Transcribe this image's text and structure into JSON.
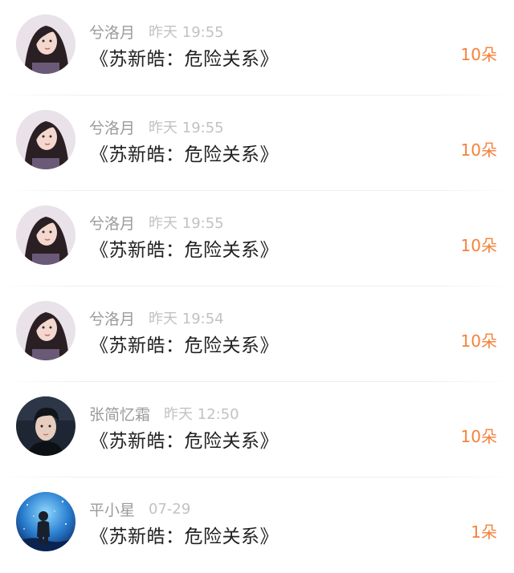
{
  "colors": {
    "username": "#9b9b9b",
    "time": "#c2c2c2",
    "title": "#222222",
    "count": "#f5813a",
    "divider": "#efefef"
  },
  "items": [
    {
      "avatar": "girl-portrait-avatar",
      "username": "兮洛月",
      "time": "昨天 19:55",
      "title": "《苏新皓：危险关系》",
      "count": "10朵"
    },
    {
      "avatar": "girl-portrait-avatar",
      "username": "兮洛月",
      "time": "昨天 19:55",
      "title": "《苏新皓：危险关系》",
      "count": "10朵"
    },
    {
      "avatar": "girl-portrait-avatar",
      "username": "兮洛月",
      "time": "昨天 19:55",
      "title": "《苏新皓：危险关系》",
      "count": "10朵"
    },
    {
      "avatar": "girl-portrait-avatar",
      "username": "兮洛月",
      "time": "昨天 19:54",
      "title": "《苏新皓：危险关系》",
      "count": "10朵"
    },
    {
      "avatar": "boy-portrait-avatar",
      "username": "张简忆霜",
      "time": "昨天 12:50",
      "title": "《苏新皓：危险关系》",
      "count": "10朵"
    },
    {
      "avatar": "night-sky-boy-avatar",
      "username": "平小星",
      "time": "07-29",
      "title": "《苏新皓：危险关系》",
      "count": "1朵"
    }
  ]
}
